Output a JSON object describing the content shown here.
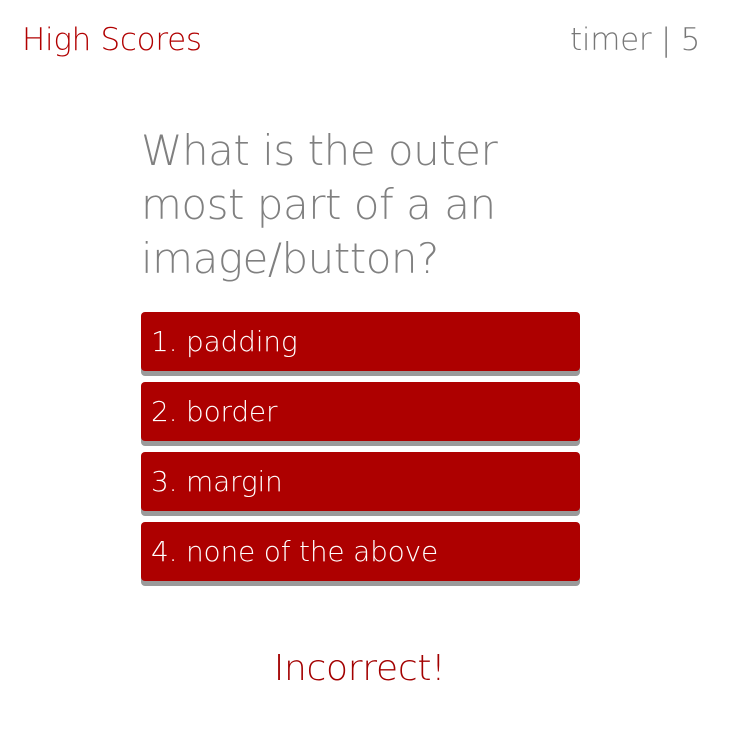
{
  "header": {
    "high_scores_label": "High Scores",
    "timer_label": "timer | 5"
  },
  "quiz": {
    "question": "What is the outer most part of a an image/button?",
    "answers": [
      {
        "label": "1. padding"
      },
      {
        "label": "2. border"
      },
      {
        "label": "3. margin"
      },
      {
        "label": "4. none of the above"
      }
    ],
    "feedback": "Incorrect!"
  },
  "colors": {
    "accent": "#ad0000",
    "text_gray": "#808080",
    "button_shadow": "#9a9a9a",
    "background": "#ffffff"
  }
}
